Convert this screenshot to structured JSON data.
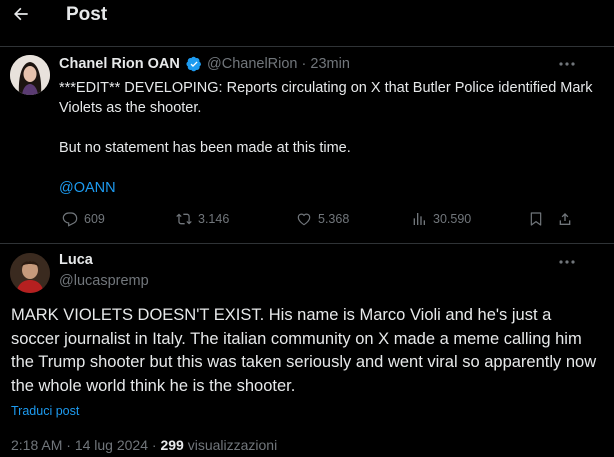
{
  "header": {
    "title": "Post"
  },
  "quoted_post": {
    "author_name": "Chanel Rion OAN",
    "handle": "@ChanelRion",
    "separator": "·",
    "time": "23min",
    "text_line1": "***EDIT** DEVELOPING: Reports circulating on X that Butler Police identified Mark Violets as the shooter.",
    "text_line2": "But no statement has been made at this time.",
    "mention": "@OANN",
    "stats": {
      "replies": "609",
      "reposts": "3.146",
      "likes": "5.368",
      "views": "30.590"
    }
  },
  "reply_post": {
    "author_name": "Luca",
    "handle": "@lucaspremp",
    "text": "MARK VIOLETS DOESN'T EXIST. His name is Marco Violi and he's just a soccer journalist in Italy. The italian community on X made a meme calling him the Trump shooter but this was taken seriously and went viral so apparently now the whole world think he is the shooter.",
    "translate_label": "Traduci post",
    "time": "2:18 AM",
    "date": "14 lug 2024",
    "views_count": "299",
    "views_label": "visualizzazioni"
  },
  "colors": {
    "background": "#000000",
    "text": "#e7e9ea",
    "muted": "#71767b",
    "accent": "#1d9bf0",
    "divider": "#2f3336"
  }
}
